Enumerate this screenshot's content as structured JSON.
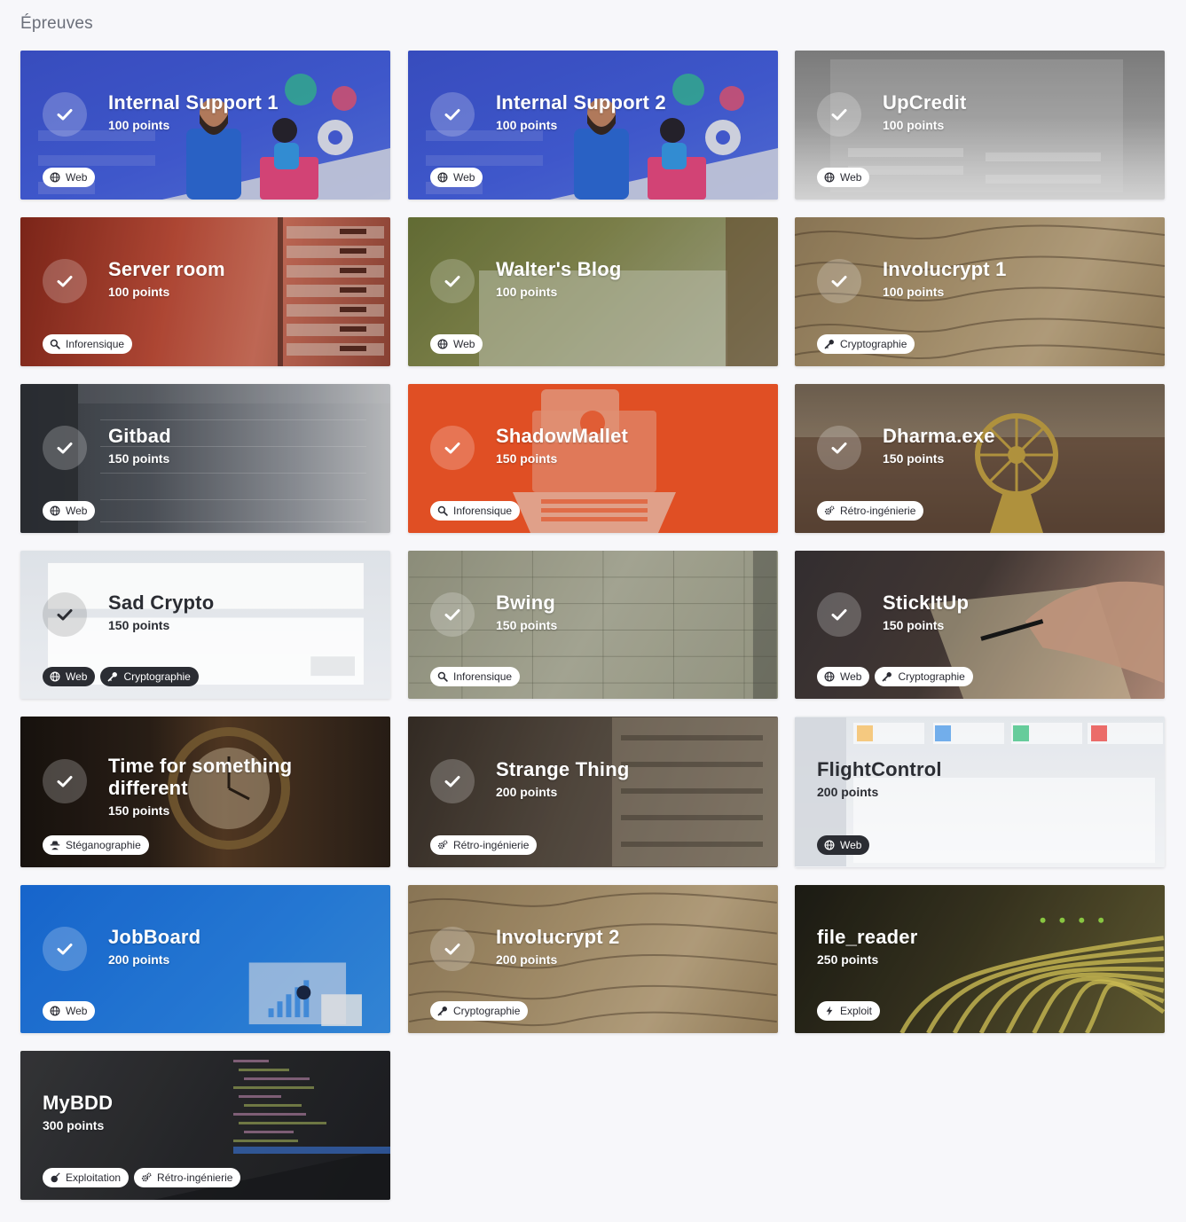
{
  "page_title": "Épreuves",
  "colors": {
    "background": "#f7f7fa",
    "tag_bg": "#ffffff",
    "tag_text": "#2a2b33"
  },
  "cards": [
    {
      "title": "Internal Support 1",
      "points": "100 points",
      "solved": true,
      "tags": [
        {
          "label": "Web",
          "icon": "globe-icon"
        }
      ],
      "theme": "blue-illustration"
    },
    {
      "title": "Internal Support 2",
      "points": "100 points",
      "solved": true,
      "tags": [
        {
          "label": "Web",
          "icon": "globe-icon"
        }
      ],
      "theme": "blue-illustration"
    },
    {
      "title": "UpCredit",
      "points": "100 points",
      "solved": true,
      "tags": [
        {
          "label": "Web",
          "icon": "globe-icon"
        }
      ],
      "theme": "grey-form"
    },
    {
      "title": "Server room",
      "points": "100 points",
      "solved": true,
      "tags": [
        {
          "label": "Inforensique",
          "icon": "search-icon"
        }
      ],
      "theme": "red-server"
    },
    {
      "title": "Walter's Blog",
      "points": "100 points",
      "solved": true,
      "tags": [
        {
          "label": "Web",
          "icon": "globe-icon"
        }
      ],
      "theme": "green-minecraft"
    },
    {
      "title": "Involucrypt 1",
      "points": "100 points",
      "solved": true,
      "tags": [
        {
          "label": "Cryptographie",
          "icon": "key-icon"
        }
      ],
      "theme": "parchment"
    },
    {
      "title": "Gitbad",
      "points": "150 points",
      "solved": true,
      "tags": [
        {
          "label": "Web",
          "icon": "globe-icon"
        }
      ],
      "theme": "dark-git"
    },
    {
      "title": "ShadowMallet",
      "points": "150 points",
      "solved": true,
      "tags": [
        {
          "label": "Inforensique",
          "icon": "search-icon"
        }
      ],
      "theme": "orange-laptop"
    },
    {
      "title": "Dharma.exe",
      "points": "150 points",
      "solved": true,
      "tags": [
        {
          "label": "Rétro-ingénierie",
          "icon": "gears-icon"
        }
      ],
      "theme": "dharma"
    },
    {
      "title": "Sad Crypto",
      "points": "150 points",
      "solved": true,
      "dark_text": true,
      "tags": [
        {
          "label": "Web",
          "icon": "globe-icon",
          "dark": true
        },
        {
          "label": "Cryptographie",
          "icon": "key-icon",
          "dark": true
        }
      ],
      "theme": "light-form"
    },
    {
      "title": "Bwing",
      "points": "150 points",
      "solved": true,
      "tags": [
        {
          "label": "Inforensique",
          "icon": "search-icon"
        }
      ],
      "theme": "blueprint"
    },
    {
      "title": "StickItUp",
      "points": "150 points",
      "solved": true,
      "tags": [
        {
          "label": "Web",
          "icon": "globe-icon"
        },
        {
          "label": "Cryptographie",
          "icon": "key-icon"
        }
      ],
      "theme": "dark-hand"
    },
    {
      "title": "Time for something different",
      "points": "150 points",
      "solved": true,
      "tags": [
        {
          "label": "Stéganographie",
          "icon": "spy-icon"
        }
      ],
      "theme": "clock"
    },
    {
      "title": "Strange Thing",
      "points": "200 points",
      "solved": true,
      "tags": [
        {
          "label": "Rétro-ingénierie",
          "icon": "gears-icon"
        }
      ],
      "theme": "stranger"
    },
    {
      "title": "FlightControl",
      "points": "200 points",
      "solved": false,
      "dark_text": true,
      "tags": [
        {
          "label": "Web",
          "icon": "globe-icon",
          "dark": true
        }
      ],
      "theme": "dashboard"
    },
    {
      "title": "JobBoard",
      "points": "200 points",
      "solved": true,
      "tags": [
        {
          "label": "Web",
          "icon": "globe-icon"
        }
      ],
      "theme": "jobboard"
    },
    {
      "title": "Involucrypt 2",
      "points": "200 points",
      "solved": true,
      "tags": [
        {
          "label": "Cryptographie",
          "icon": "key-icon"
        }
      ],
      "theme": "parchment"
    },
    {
      "title": "file_reader",
      "points": "250 points",
      "solved": false,
      "tags": [
        {
          "label": "Exploit",
          "icon": "bolt-icon"
        }
      ],
      "theme": "cables"
    },
    {
      "title": "MyBDD",
      "points": "300 points",
      "solved": false,
      "tags": [
        {
          "label": "Exploitation",
          "icon": "bomb-icon"
        },
        {
          "label": "Rétro-ingénierie",
          "icon": "gears-icon"
        }
      ],
      "theme": "code"
    }
  ]
}
